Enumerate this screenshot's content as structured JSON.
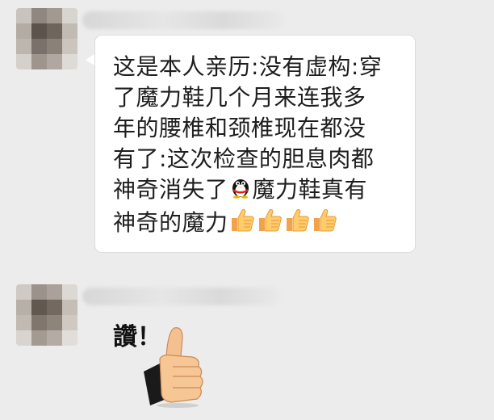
{
  "messages": [
    {
      "sender_avatar": "blurred-avatar",
      "line1": "这是本人亲历:没有虚构:穿",
      "line2": "了魔力鞋几个月来连我多",
      "line3": "年的腰椎和颈椎现在都没",
      "line4": "有了:这次检查的胆息肉都",
      "line5a": "神奇消失了",
      "line5b": "魔力鞋真有",
      "line6": "神奇的魔力",
      "icons": [
        "penguin-emoji-icon",
        "thumbs-up-emoji-icon"
      ]
    },
    {
      "sender_avatar": "blurred-avatar",
      "sticker_text": "讚！",
      "sticker_icon": "thumbs-up-hand-sticker"
    }
  ],
  "colors": {
    "background": "#ececec",
    "bubble": "#ffffff",
    "text": "#1e1e1e"
  }
}
